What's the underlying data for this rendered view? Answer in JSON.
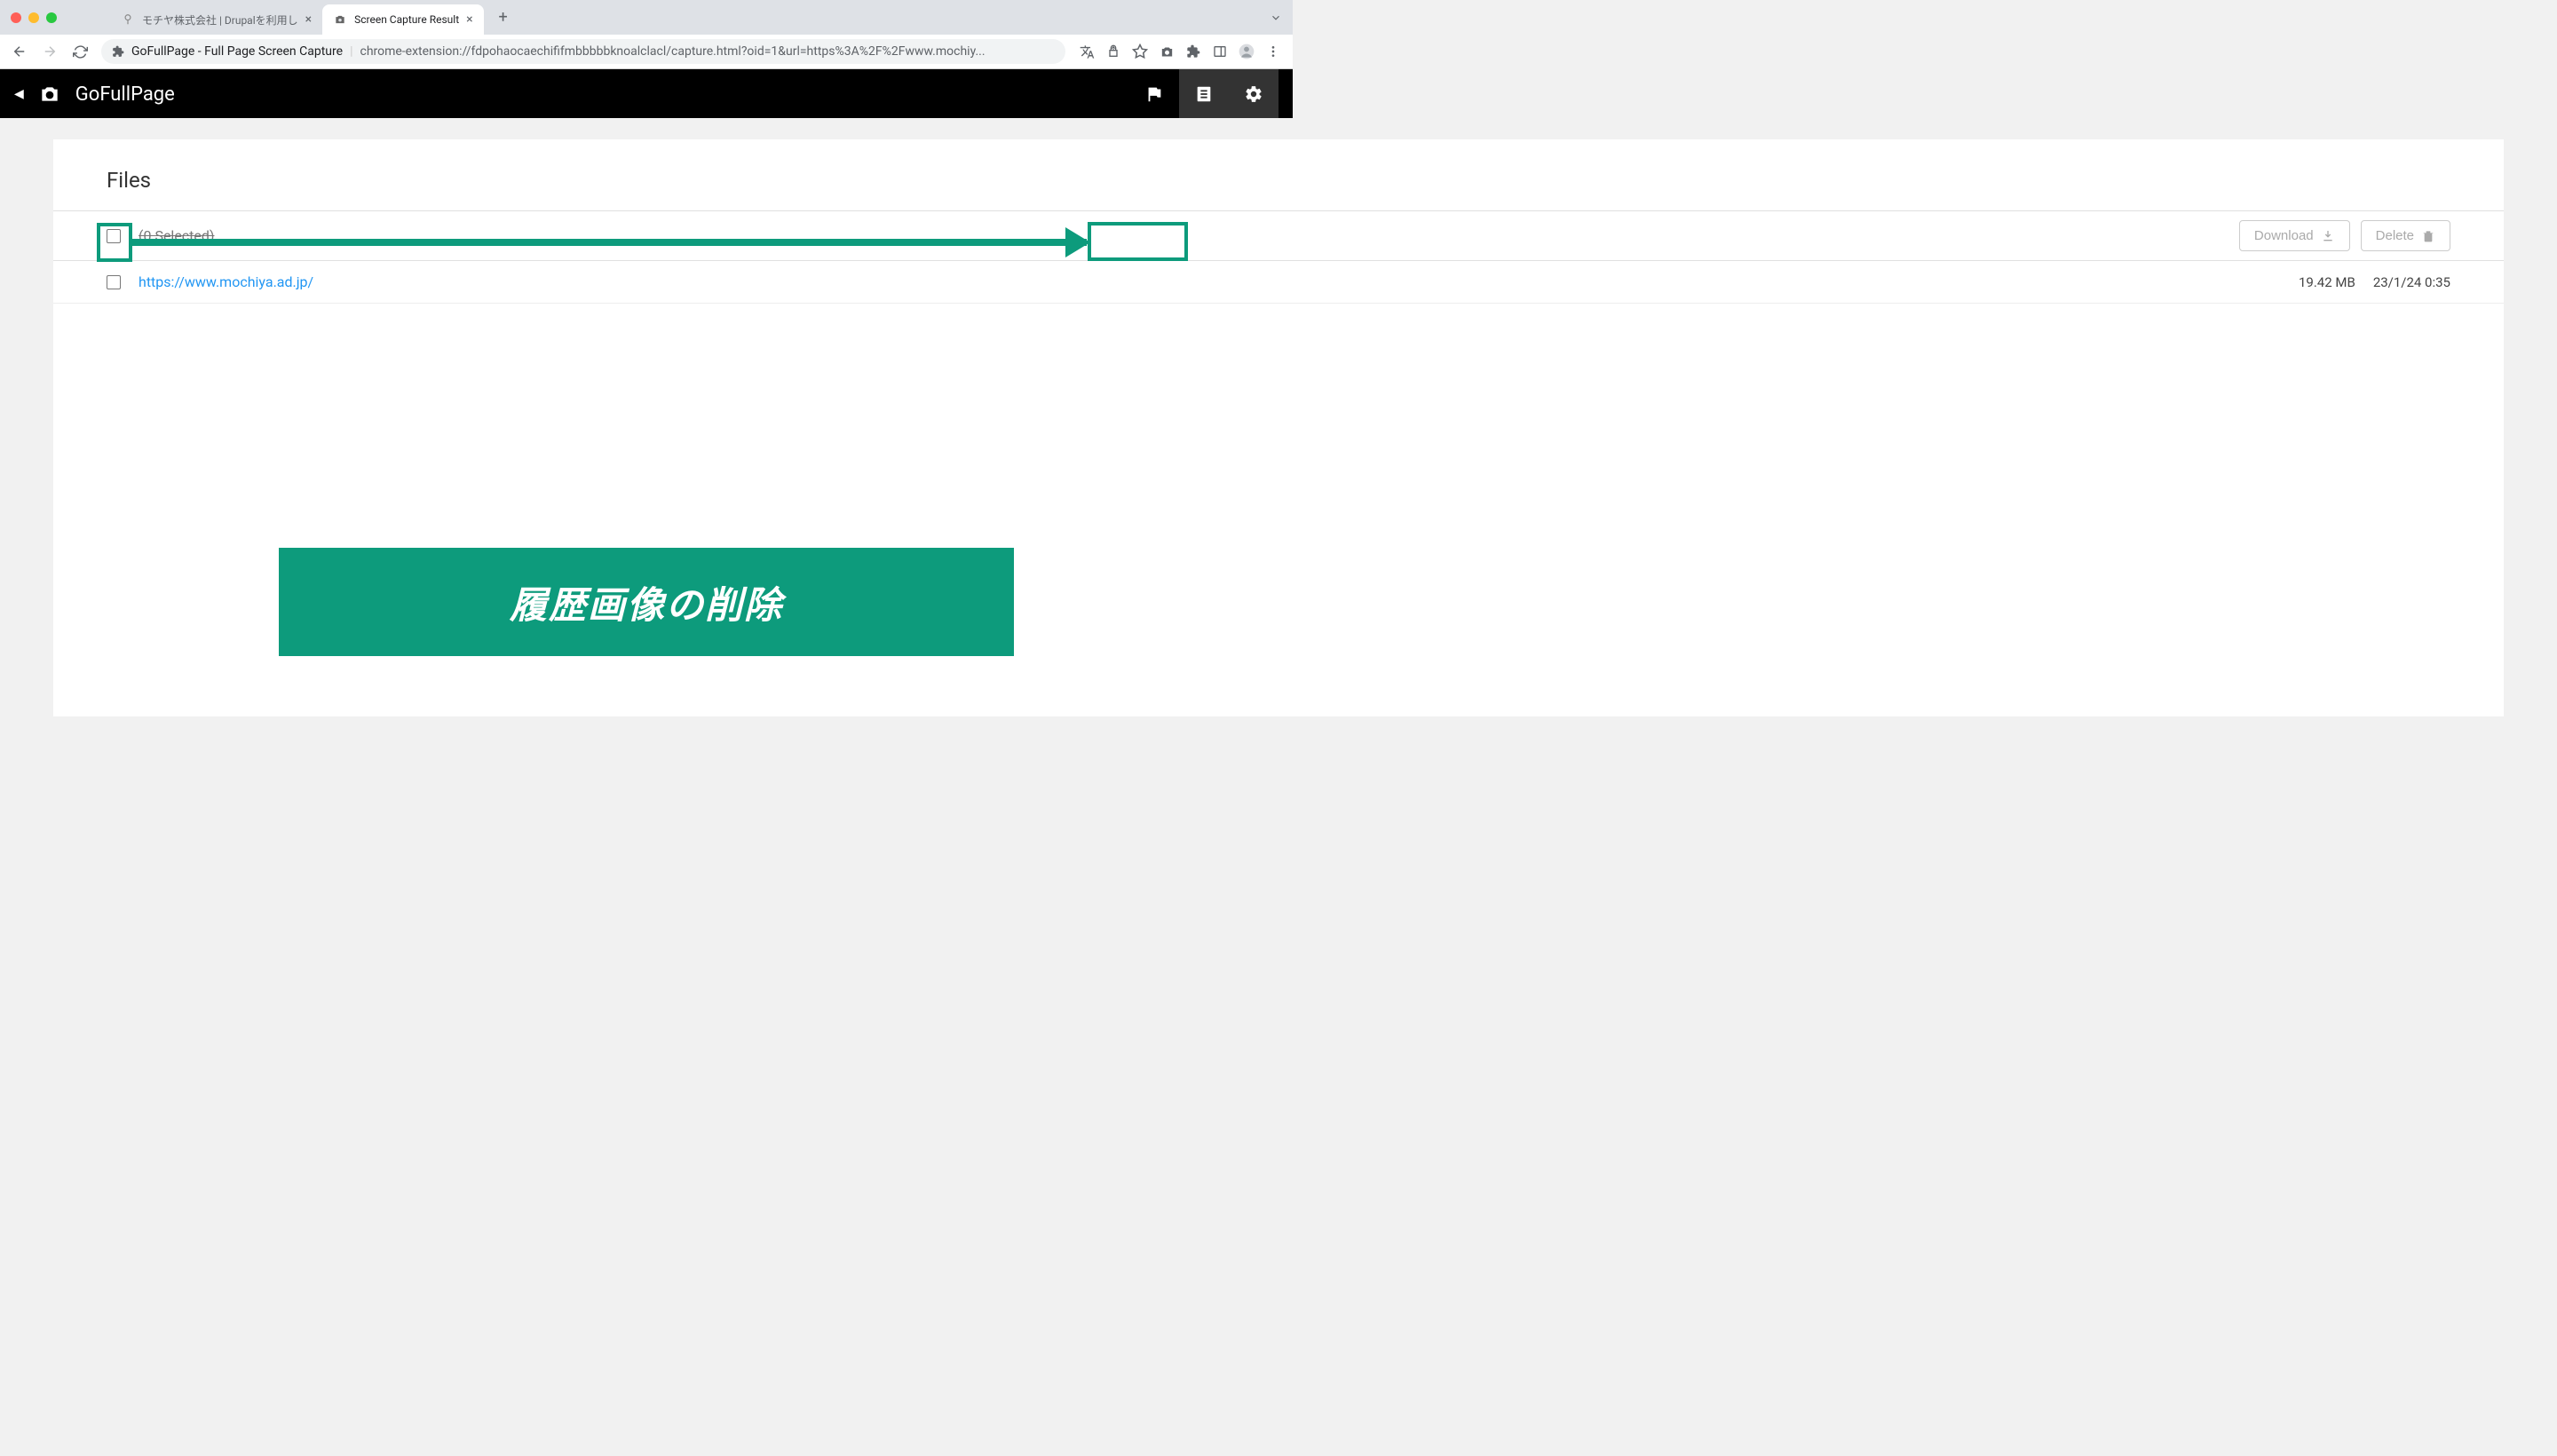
{
  "browser": {
    "tabs": [
      {
        "title": "モチヤ株式会社 | Drupalを利用し"
      },
      {
        "title": "Screen Capture Result"
      }
    ],
    "url_title": "GoFullPage - Full Page Screen Capture",
    "url_path": "chrome-extension://fdpohaocaechififmbbbbbknoalclacl/capture.html?oid=1&url=https%3A%2F%2Fwww.mochiy..."
  },
  "app": {
    "title": "GoFullPage"
  },
  "content": {
    "heading": "Files",
    "selected_text": "(0 Selected)",
    "download_label": "Download",
    "delete_label": "Delete",
    "file": {
      "url": "https://www.mochiya.ad.jp/",
      "size": "19.42 MB",
      "date": "23/1/24 0:35"
    }
  },
  "annotation": {
    "banner_text": "履歴画像の削除"
  }
}
